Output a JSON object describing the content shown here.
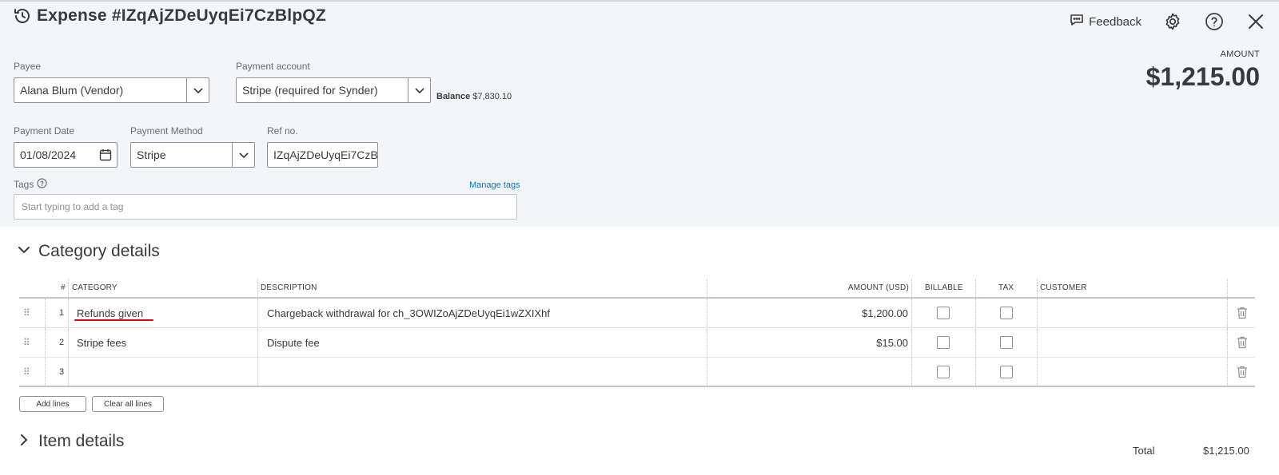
{
  "header": {
    "title": "Expense #IZqAjZDeUyqEi7CzBlpQZ",
    "feedback_label": "Feedback",
    "icons": [
      "history-icon",
      "feedback-icon",
      "gear-icon",
      "help-icon",
      "close-icon"
    ]
  },
  "amount": {
    "label": "AMOUNT",
    "value": "$1,215.00"
  },
  "form": {
    "payee": {
      "label": "Payee",
      "value": "Alana Blum (Vendor)"
    },
    "payment_account": {
      "label": "Payment account",
      "value": "Stripe (required for Synder)"
    },
    "balance": {
      "label": "Balance",
      "value": "$7,830.10"
    },
    "payment_date": {
      "label": "Payment Date",
      "value": "01/08/2024"
    },
    "payment_method": {
      "label": "Payment Method",
      "value": "Stripe"
    },
    "ref_no": {
      "label": "Ref no.",
      "value": "IZqAjZDeUyqEi7CzB"
    },
    "tags": {
      "label": "Tags",
      "manage_label": "Manage tags",
      "placeholder": "Start typing to add a tag"
    }
  },
  "category_details": {
    "title": "Category details",
    "columns": {
      "num": "#",
      "category": "CATEGORY",
      "description": "DESCRIPTION",
      "amount": "AMOUNT (USD)",
      "billable": "BILLABLE",
      "tax": "TAX",
      "customer": "CUSTOMER"
    },
    "rows": [
      {
        "num": "1",
        "category": "Refunds given",
        "description": "Chargeback withdrawal for ch_3OWIZoAjZDeUyqEi1wZXIXhf",
        "amount": "$1,200.00"
      },
      {
        "num": "2",
        "category": "Stripe fees",
        "description": "Dispute fee",
        "amount": "$15.00"
      },
      {
        "num": "3",
        "category": "",
        "description": "",
        "amount": ""
      }
    ],
    "add_lines_label": "Add lines",
    "clear_lines_label": "Clear all lines"
  },
  "item_details": {
    "title": "Item details"
  },
  "total": {
    "label": "Total",
    "value": "$1,215.00"
  },
  "colors": {
    "accent_link": "#0077c5",
    "annotation_underline": "#e0001b",
    "panel_bg": "#f4f5f8"
  }
}
